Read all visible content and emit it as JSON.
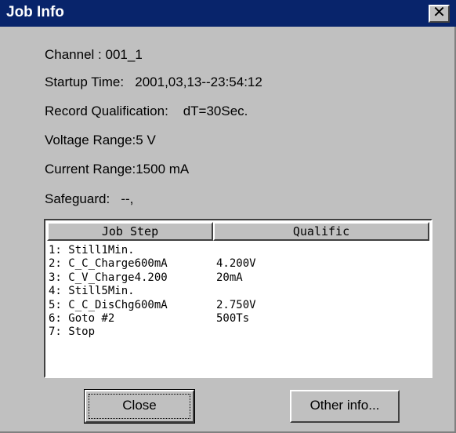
{
  "window": {
    "title": "Job Info",
    "close_glyph": "✕"
  },
  "info": {
    "channel": "Channel : 001_1",
    "startup_time": "Startup Time:   2001,03,13--23:54:12",
    "record_qualification": "Record Qualification:    dT=30Sec.",
    "voltage_range": "Voltage Range:5 V",
    "current_range": "Current Range:1500 mA",
    "safeguard": "Safeguard:   --,"
  },
  "table": {
    "columns": [
      "Job Step",
      "Qualific"
    ],
    "rows": [
      {
        "step": "1: Still1Min.",
        "qual": ""
      },
      {
        "step": "2: C_C_Charge600mA",
        "qual": "4.200V"
      },
      {
        "step": "3: C_V_Charge4.200",
        "qual": "20mA"
      },
      {
        "step": "4: Still5Min.",
        "qual": ""
      },
      {
        "step": "5: C_C_DisChg600mA",
        "qual": "2.750V"
      },
      {
        "step": "6: Goto #2",
        "qual": "500Ts"
      },
      {
        "step": "7: Stop",
        "qual": ""
      }
    ]
  },
  "buttons": {
    "close": "Close",
    "other_info": "Other info..."
  }
}
